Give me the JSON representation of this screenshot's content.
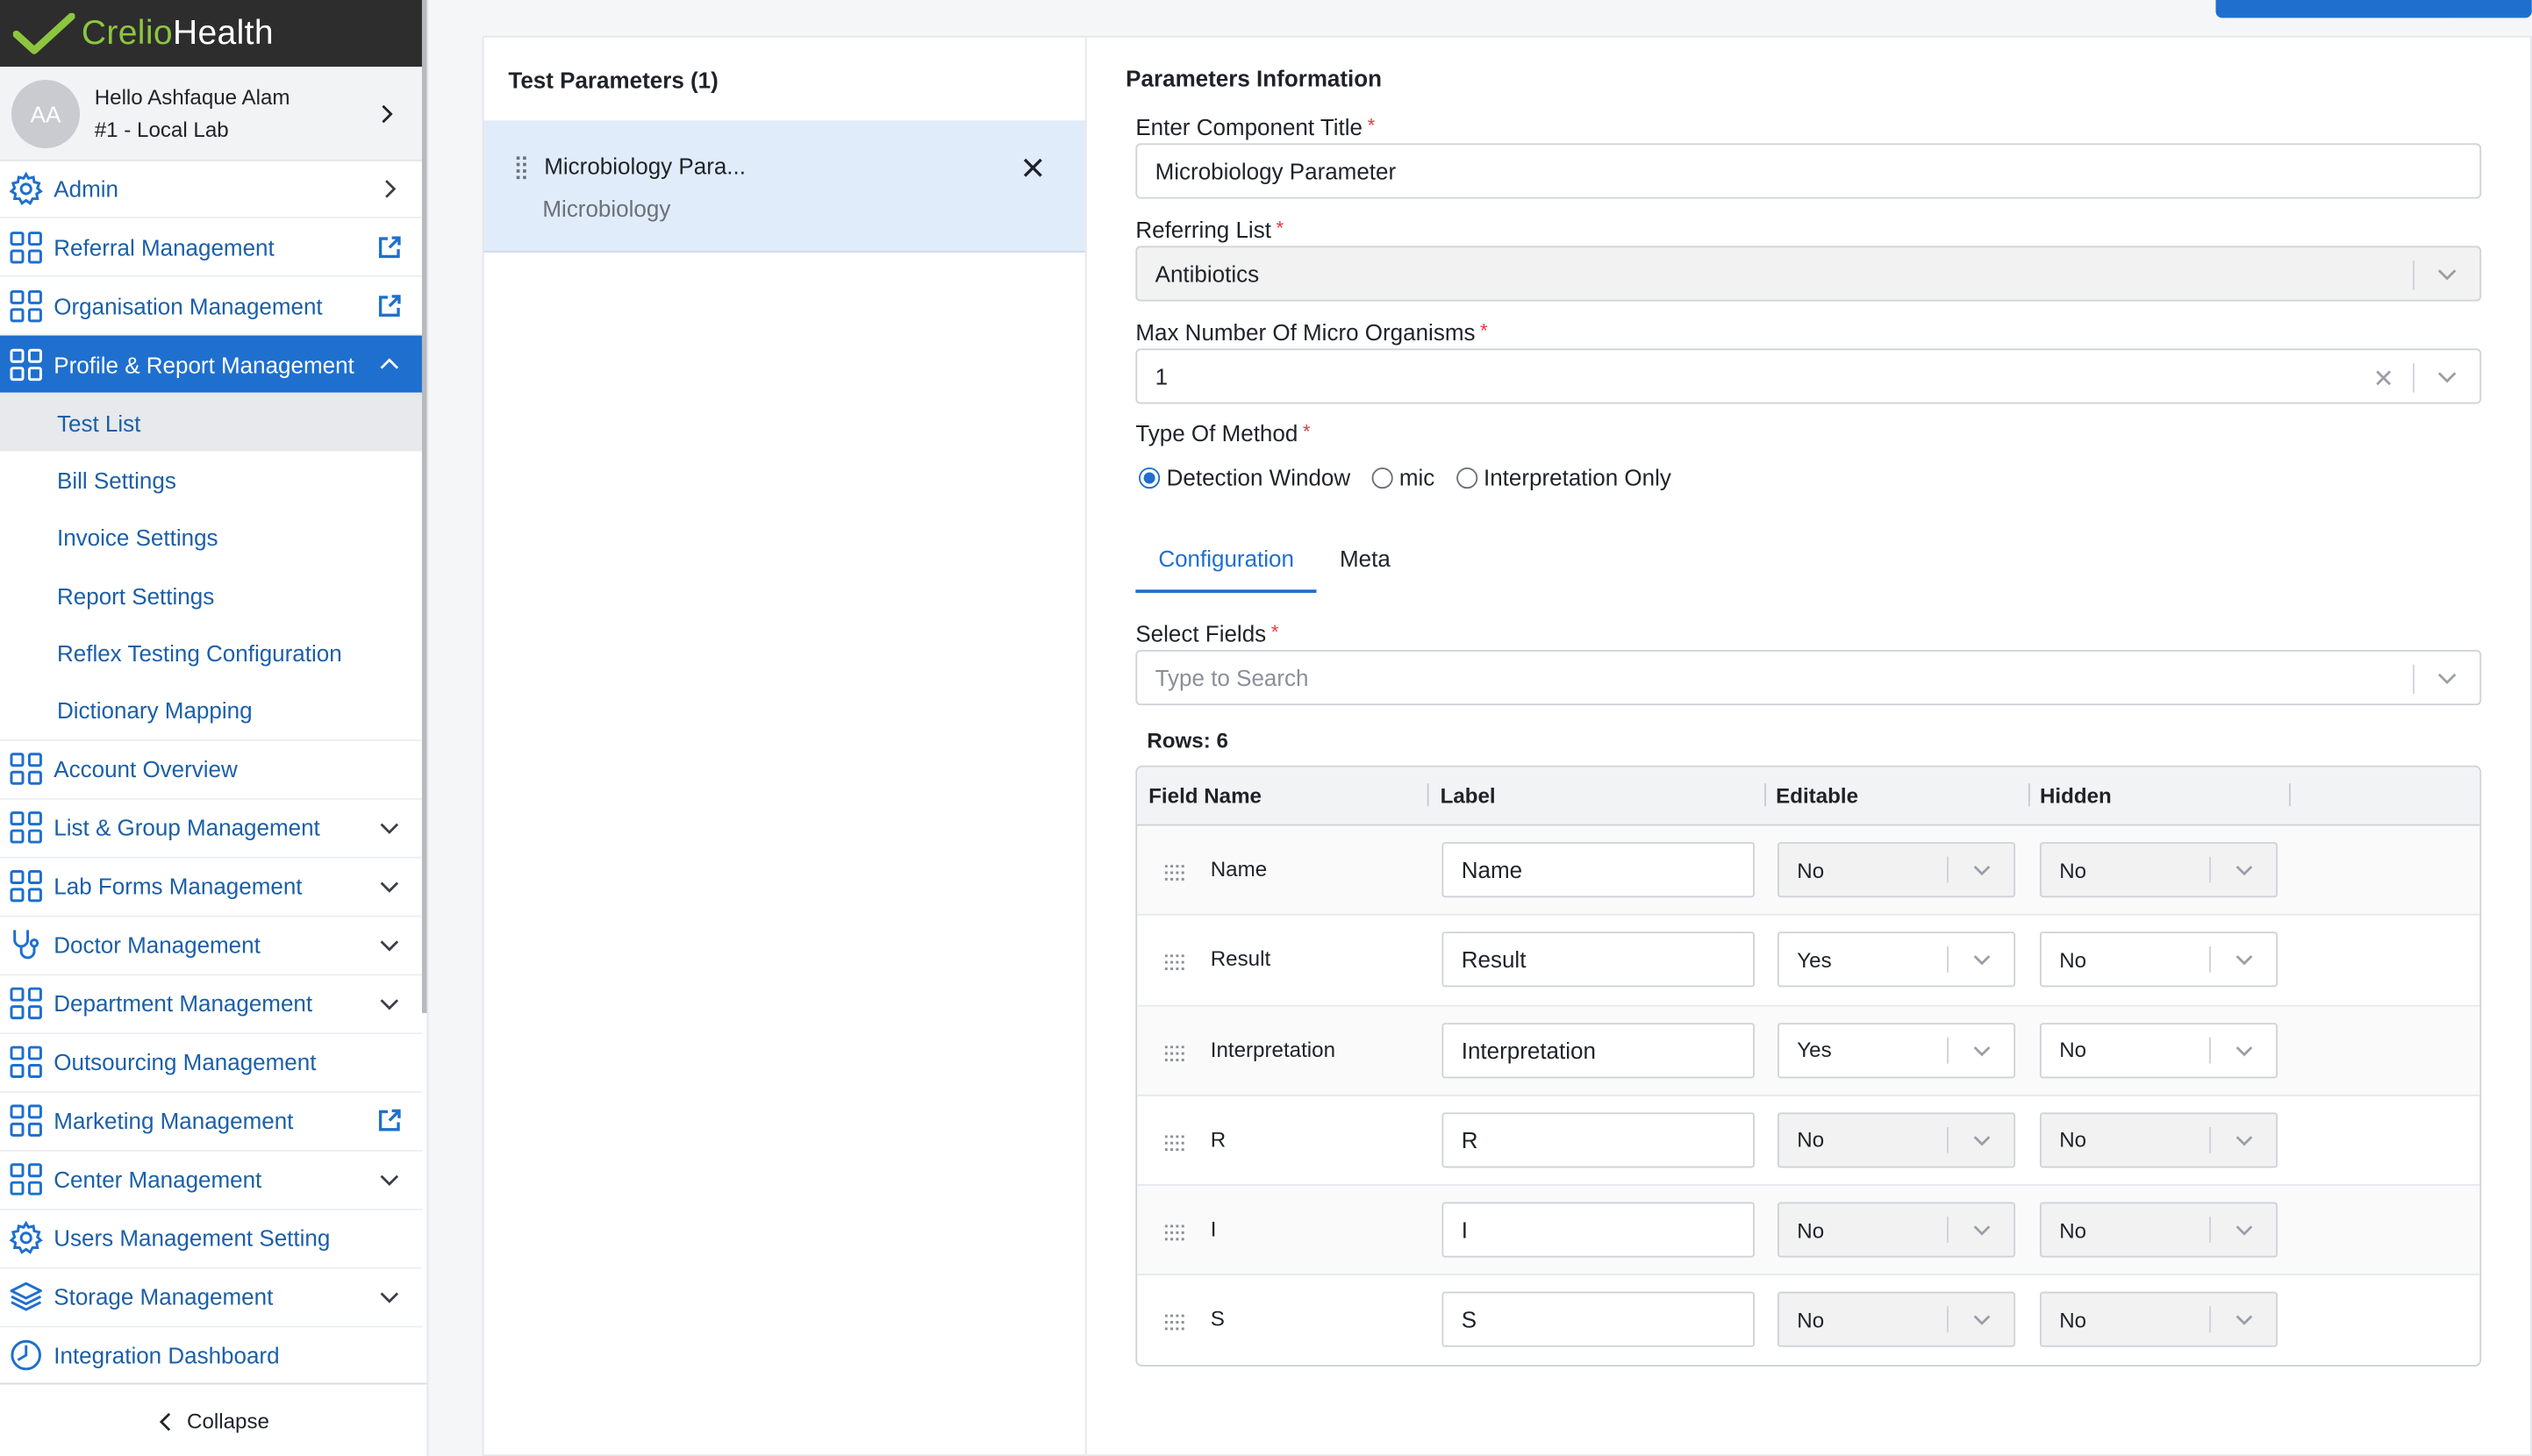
{
  "brand": {
    "name_part1": "Crelio",
    "name_part2": "Health",
    "accent": "#8cc63f"
  },
  "user": {
    "initials": "AA",
    "greeting": "Hello Ashfaque Alam",
    "lab": "#1 - Local Lab"
  },
  "sidebar": {
    "items": [
      {
        "label": "Admin",
        "icon": "gear-icon",
        "right": "chevron-right"
      },
      {
        "label": "Referral Management",
        "icon": "grid-icon",
        "right": "external-link"
      },
      {
        "label": "Organisation Management",
        "icon": "grid-icon",
        "right": "external-link"
      },
      {
        "label": "Profile & Report Management",
        "icon": "grid-icon",
        "right": "chevron-up",
        "active": true
      }
    ],
    "subitems": [
      {
        "label": "Test List",
        "current": true
      },
      {
        "label": "Bill Settings"
      },
      {
        "label": "Invoice Settings"
      },
      {
        "label": "Report Settings"
      },
      {
        "label": "Reflex Testing Configuration"
      },
      {
        "label": "Dictionary Mapping"
      }
    ],
    "items_after": [
      {
        "label": "Account Overview",
        "icon": "grid-icon",
        "right": ""
      },
      {
        "label": "List & Group Management",
        "icon": "grid-icon",
        "right": "chevron-down"
      },
      {
        "label": "Lab Forms Management",
        "icon": "grid-icon",
        "right": "chevron-down"
      },
      {
        "label": "Doctor Management",
        "icon": "stethoscope-icon",
        "right": "chevron-down"
      },
      {
        "label": "Department Management",
        "icon": "grid-icon",
        "right": "chevron-down"
      },
      {
        "label": "Outsourcing Management",
        "icon": "grid-icon",
        "right": ""
      },
      {
        "label": "Marketing Management",
        "icon": "grid-icon",
        "right": "external-link"
      },
      {
        "label": "Center Management",
        "icon": "grid-icon",
        "right": "chevron-down"
      },
      {
        "label": "Users Management Setting",
        "icon": "gear-icon",
        "right": ""
      },
      {
        "label": "Storage Management",
        "icon": "layers-icon",
        "right": "chevron-down"
      },
      {
        "label": "Integration Dashboard",
        "icon": "clock-icon",
        "right": ""
      }
    ],
    "collapse_label": "Collapse"
  },
  "test_parameters": {
    "header": "Test Parameters (1)",
    "card": {
      "name": "Microbiology Para...",
      "category": "Microbiology"
    }
  },
  "parameters_info": {
    "title": "Parameters Information",
    "component_title_label": "Enter Component Title",
    "component_title_value": "Microbiology Parameter",
    "referring_list_label": "Referring List",
    "referring_list_value": "Antibiotics",
    "max_micro_label": "Max Number Of Micro Organisms",
    "max_micro_value": "1",
    "method_label": "Type Of Method",
    "method_options": [
      "Detection Window",
      "mic",
      "Interpretation Only"
    ],
    "method_selected": "Detection Window",
    "tabs": [
      "Configuration",
      "Meta"
    ],
    "active_tab": "Configuration",
    "select_fields_label": "Select Fields",
    "select_fields_placeholder": "Type to Search",
    "required_mark": "*"
  },
  "fields_table": {
    "rows_label": "Rows: 6",
    "columns": [
      "Field Name",
      "Label",
      "Editable",
      "Hidden"
    ],
    "rows": [
      {
        "field": "Name",
        "label": "Name",
        "editable": "No",
        "hidden": "No"
      },
      {
        "field": "Result",
        "label": "Result",
        "editable": "Yes",
        "hidden": "No"
      },
      {
        "field": "Interpretation",
        "label": "Interpretation",
        "editable": "Yes",
        "hidden": "No"
      },
      {
        "field": "R",
        "label": "R",
        "editable": "No",
        "hidden": "No"
      },
      {
        "field": "I",
        "label": "I",
        "editable": "No",
        "hidden": "No"
      },
      {
        "field": "S",
        "label": "S",
        "editable": "No",
        "hidden": "No"
      }
    ]
  }
}
